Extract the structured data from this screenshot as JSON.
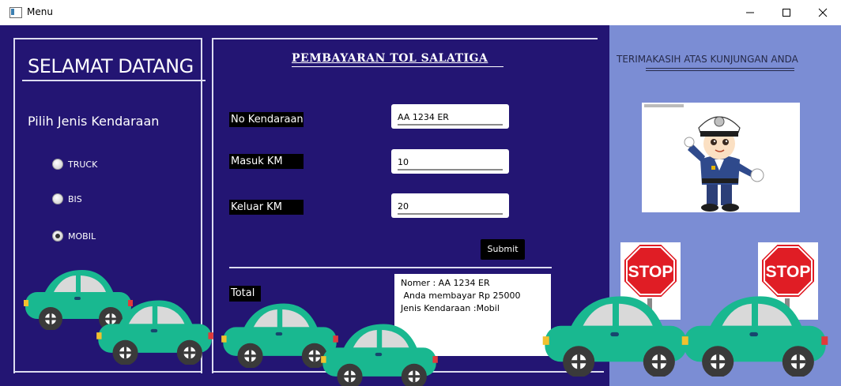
{
  "window": {
    "title": "Menu",
    "icons": {
      "app": "app-window-icon",
      "minimize": "minimize-icon",
      "maximize": "maximize-icon",
      "close": "close-icon"
    }
  },
  "left": {
    "welcome": "SELAMAT DATANG",
    "choose_label": "Pilih Jenis Kendaraan",
    "vehicle_options": [
      {
        "label": "TRUCK",
        "selected": false
      },
      {
        "label": "BIS",
        "selected": false
      },
      {
        "label": "MOBIL",
        "selected": true
      }
    ]
  },
  "form": {
    "title": "PEMBAYARAN TOL SALATIGA",
    "fields": [
      {
        "label": "No Kendaraan",
        "value": "AA 1234 ER"
      },
      {
        "label": "Masuk KM",
        "value": "10"
      },
      {
        "label": "Keluar KM",
        "value": "20"
      }
    ],
    "submit_label": "Submit",
    "total_label": "Total",
    "result_lines": [
      "Nomer : AA 1234 ER",
      " Anda membayar Rp 25000",
      "Jenis Kendaraan :Mobil"
    ]
  },
  "right": {
    "thanks": "TERIMAKASIH ATAS KUNJUNGAN ANDA",
    "police_image": "police-officer-saluting",
    "stop_sign_text": "STOP"
  },
  "colors": {
    "background": "#231573",
    "right_panel": "#7b8dd4",
    "car_body": "#19b890",
    "stop_red": "#e01d25"
  }
}
